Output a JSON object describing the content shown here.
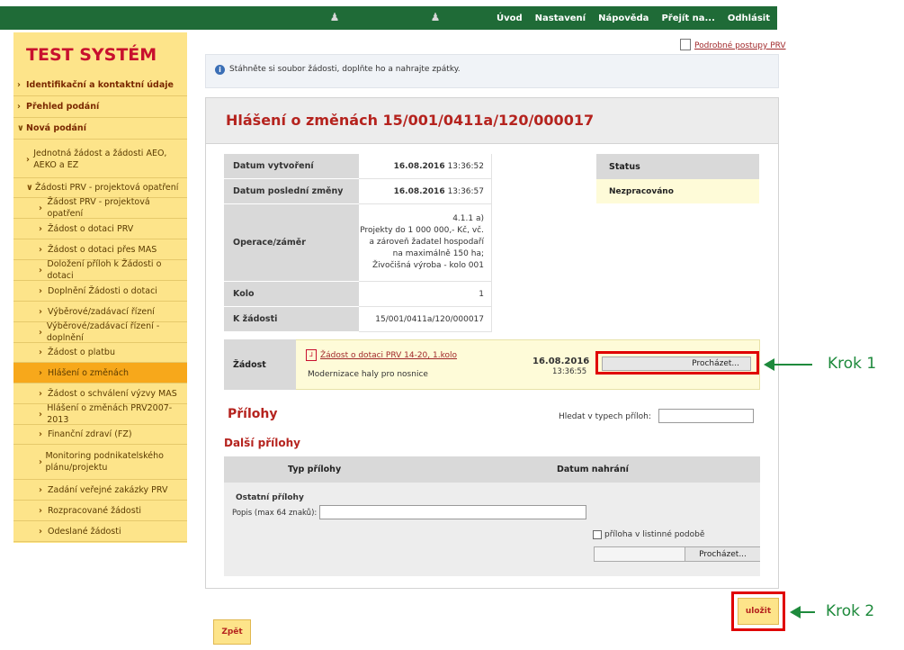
{
  "topnav": {
    "items": [
      "Úvod",
      "Nastavení",
      "Nápověda",
      "Přejít na...",
      "Odhlásit"
    ]
  },
  "sidebar": {
    "brand": "TEST SYSTÉM",
    "items": [
      {
        "label": "Identifikační a kontaktní údaje",
        "level": 0
      },
      {
        "label": "Přehled podání",
        "level": 0
      },
      {
        "label": "Nová podání",
        "level": 0
      },
      {
        "label": "Jednotná žádost a žádosti AEO, AEKO a EZ",
        "level": 1
      },
      {
        "label": "Žádosti PRV - projektová opatření",
        "level": 1
      },
      {
        "label": "Žádost PRV - projektová opatření",
        "level": 2
      },
      {
        "label": "Žádost o dotaci PRV",
        "level": 2
      },
      {
        "label": "Žádost o dotaci přes MAS",
        "level": 2
      },
      {
        "label": "Doložení příloh k Žádosti o dotaci",
        "level": 2
      },
      {
        "label": "Doplnění Žádosti o dotaci",
        "level": 2
      },
      {
        "label": "Výběrové/zadávací řízení",
        "level": 2
      },
      {
        "label": "Výběrové/zadávací řízení - doplnění",
        "level": 2
      },
      {
        "label": "Žádost o platbu",
        "level": 2
      },
      {
        "label": "Hlášení o změnách",
        "level": 2
      },
      {
        "label": "Žádost o schválení výzvy MAS",
        "level": 2
      },
      {
        "label": "Hlášení o změnách PRV2007-2013",
        "level": 2
      },
      {
        "label": "Finanční zdraví (FZ)",
        "level": 2
      },
      {
        "label": "Monitoring podnikatelského plánu/projektu",
        "level": 2
      },
      {
        "label": "Zadání veřejné zakázky PRV",
        "level": 2
      },
      {
        "label": "Rozpracované žádosti",
        "level": 2
      },
      {
        "label": "Odeslané žádosti",
        "level": 2
      }
    ]
  },
  "header": {
    "procedures_link": "Podrobné postupy PRV",
    "info": "Stáhněte si soubor žádosti, doplňte ho a nahrajte zpátky."
  },
  "form": {
    "title": "Hlášení o změnách 15/001/0411a/120/000017",
    "rows": {
      "created_label": "Datum vytvoření",
      "created_date": "16.08.2016",
      "created_time": "13:36:52",
      "changed_label": "Datum poslední změny",
      "changed_date": "16.08.2016",
      "changed_time": "13:36:57",
      "operation_label": "Operace/záměr",
      "operation_lines": [
        "4.1.1 a)",
        "Projekty do 1 000 000,- Kč, vč.",
        "a zároveň žadatel hospodaří",
        "na maximálně 150 ha;",
        "Živočišná výroba - kolo 001"
      ],
      "round_label": "Kolo",
      "round_value": "1",
      "request_label": "K žádosti",
      "request_value": "15/001/0411a/120/000017"
    },
    "status_label": "Status",
    "status_value": "Nezpracováno",
    "zadost": {
      "label": "Žádost",
      "file_link": "Žádost o dotaci PRV 14-20, 1.kolo",
      "description": "Modernizace haly pro nosnice",
      "date": "16.08.2016",
      "time": "13:36:55",
      "browse_label": "Procházet..."
    }
  },
  "attachments": {
    "title": "Přílohy",
    "search_label": "Hledat v typech příloh:",
    "subtitle": "Další přílohy",
    "col_type": "Typ přílohy",
    "col_date": "Datum nahrání",
    "category": "Ostatní přílohy",
    "desc_label": "Popis (max 64 znaků):",
    "paper_label": "příloha v listinné podobě",
    "browse_label": "Procházet..."
  },
  "actions": {
    "save": "uložit",
    "back": "Zpět"
  },
  "annotations": {
    "step1": "Krok 1",
    "step2": "Krok 2"
  }
}
